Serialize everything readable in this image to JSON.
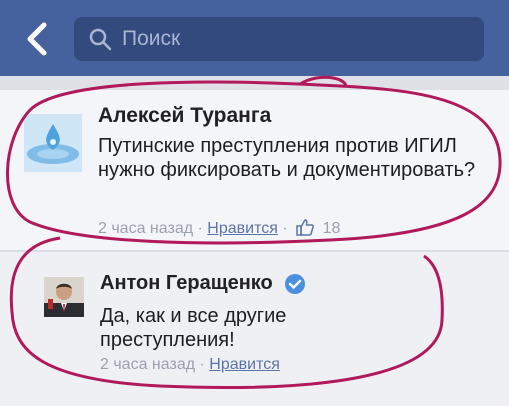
{
  "header": {
    "back_icon": "chevron-left-icon",
    "search_placeholder": "Поиск",
    "search_icon": "search-icon"
  },
  "comments": [
    {
      "author": "Алексей Туранга",
      "text": "Путинские преступления против ИГИЛ нужно фиксировать и документировать?",
      "time": "2 часа назад",
      "dot": "·",
      "like_label": "Нравится",
      "like_count": "18",
      "avatar_icon": "water-drop-avatar"
    },
    {
      "author": "Антон Геращенко",
      "verified": true,
      "text": "Да, как и все другие преступления!",
      "time": "2 часа назад",
      "dot": "·",
      "like_label": "Нравится",
      "avatar_icon": "person-avatar"
    }
  ],
  "colors": {
    "header": "#46629e",
    "search_bg": "#324a7d",
    "link": "#5b74a8",
    "annotation": "#b0195a"
  }
}
